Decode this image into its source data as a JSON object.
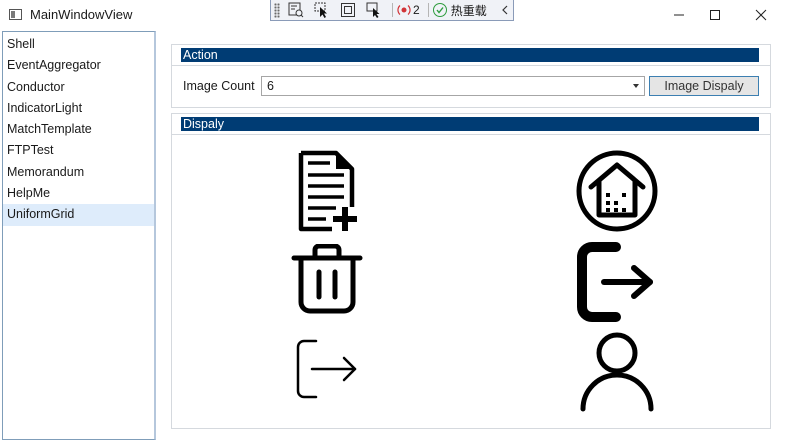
{
  "window": {
    "title": "MainWindowView"
  },
  "debug_toolbar": {
    "error_count": "2",
    "hot_reload_label": "热重载"
  },
  "sidebar": {
    "items": [
      {
        "label": "Shell"
      },
      {
        "label": "EventAggregator"
      },
      {
        "label": "Conductor"
      },
      {
        "label": "IndicatorLight"
      },
      {
        "label": "MatchTemplate"
      },
      {
        "label": "FTPTest"
      },
      {
        "label": "Memorandum"
      },
      {
        "label": "HelpMe"
      },
      {
        "label": "UniformGrid"
      }
    ],
    "selected": "UniformGrid"
  },
  "action_group": {
    "header": "Action",
    "image_count_label": "Image Count",
    "image_count_value": "6",
    "button_label": "Image Dispaly"
  },
  "display_group": {
    "header": "Dispaly",
    "images": [
      {
        "icon": "add-document-icon"
      },
      {
        "icon": "home-circle-icon"
      },
      {
        "icon": "trash-icon"
      },
      {
        "icon": "logout-bold-icon"
      },
      {
        "icon": "logout-thin-icon"
      },
      {
        "icon": "user-icon"
      }
    ]
  },
  "colors": {
    "group_header_bg": "#003c74",
    "selected_item_bg": "#deecfb",
    "border": "#7f9db9"
  }
}
